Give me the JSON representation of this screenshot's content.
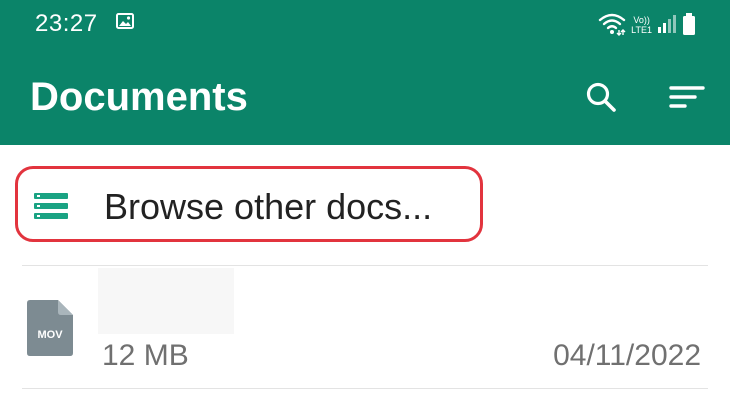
{
  "status_bar": {
    "time": "23:27",
    "volte_top": "Vo))",
    "volte_bottom": "LTE1"
  },
  "header": {
    "title": "Documents",
    "background": "#0b8469",
    "search_icon": "search-icon",
    "sort_icon": "sort-icon"
  },
  "browse": {
    "label": "Browse other docs...",
    "icon": "list-icon",
    "icon_color": "#1aa383",
    "highlight_color": "#e2343e"
  },
  "files": [
    {
      "type_label": "MOV",
      "size": "12 MB",
      "date": "04/11/2022"
    }
  ]
}
